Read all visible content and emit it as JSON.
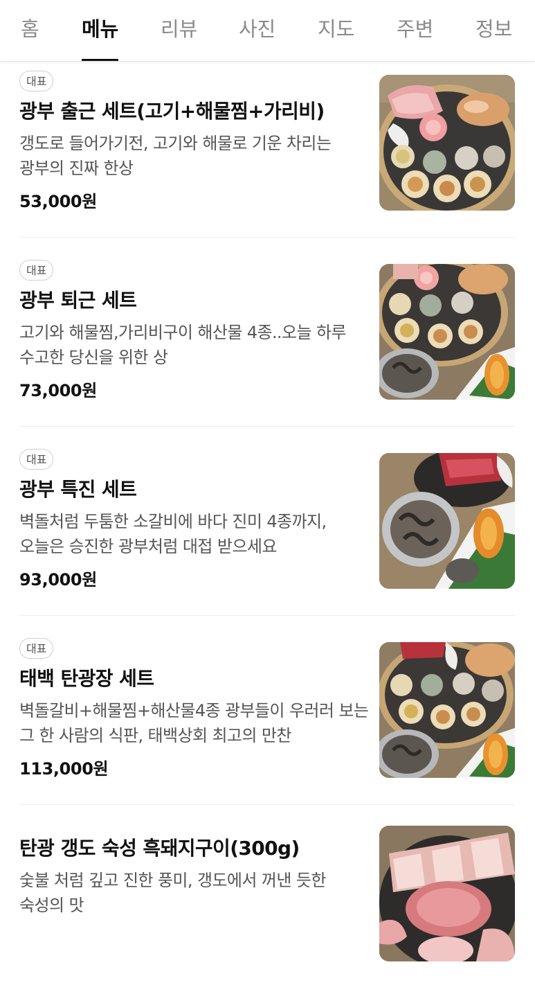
{
  "tabs": [
    {
      "label": "홈",
      "active": false
    },
    {
      "label": "메뉴",
      "active": true
    },
    {
      "label": "리뷰",
      "active": false
    },
    {
      "label": "사진",
      "active": false
    },
    {
      "label": "지도",
      "active": false
    },
    {
      "label": "주변",
      "active": false
    },
    {
      "label": "정보",
      "active": false
    }
  ],
  "menu": {
    "items": [
      {
        "badge": "대표",
        "name": "광부 출근 세트(고기+해물찜+가리비)",
        "description": "갱도로 들어가기전, 고기와 해물로 기운 차리는 광부의 진짜 한상",
        "price": "53,000원",
        "photo": "meat-seafood-platter-photo"
      },
      {
        "badge": "대표",
        "name": "광부 퇴근 세트",
        "description": "고기와 해물찜,가리비구이 해산물 4종..오늘 하루 수고한 당신을 위한 상",
        "price": "73,000원",
        "photo": "seafood-set-photo"
      },
      {
        "badge": "대표",
        "name": "광부 특진 세트",
        "description": "벽돌처럼 두툼한 소갈비에 바다 진미 4종까지, 오늘은 승진한 광부처럼 대접 받으세요",
        "price": "93,000원",
        "photo": "beef-rib-seafood-photo"
      },
      {
        "badge": "대표",
        "name": "태백 탄광장 세트",
        "description": "벽돌갈비+해물찜+해산물4종 광부들이 우러러 보는 그 한 사람의 식판, 태백상회 최고의 만찬",
        "price": "113,000원",
        "photo": "full-course-platter-photo"
      },
      {
        "badge": "",
        "name": "탄광 갱도 숙성 흑돼지구이(300g)",
        "description": "숯불 처럼 깊고 진한 풍미, 갱도에서 꺼낸 듯한 숙성의 맛",
        "price": "",
        "photo": "aged-black-pork-photo"
      }
    ]
  },
  "colors": {
    "active_tab": "#111111",
    "inactive_tab": "#8a8a8a",
    "description": "#555555",
    "divider": "#ececec"
  }
}
